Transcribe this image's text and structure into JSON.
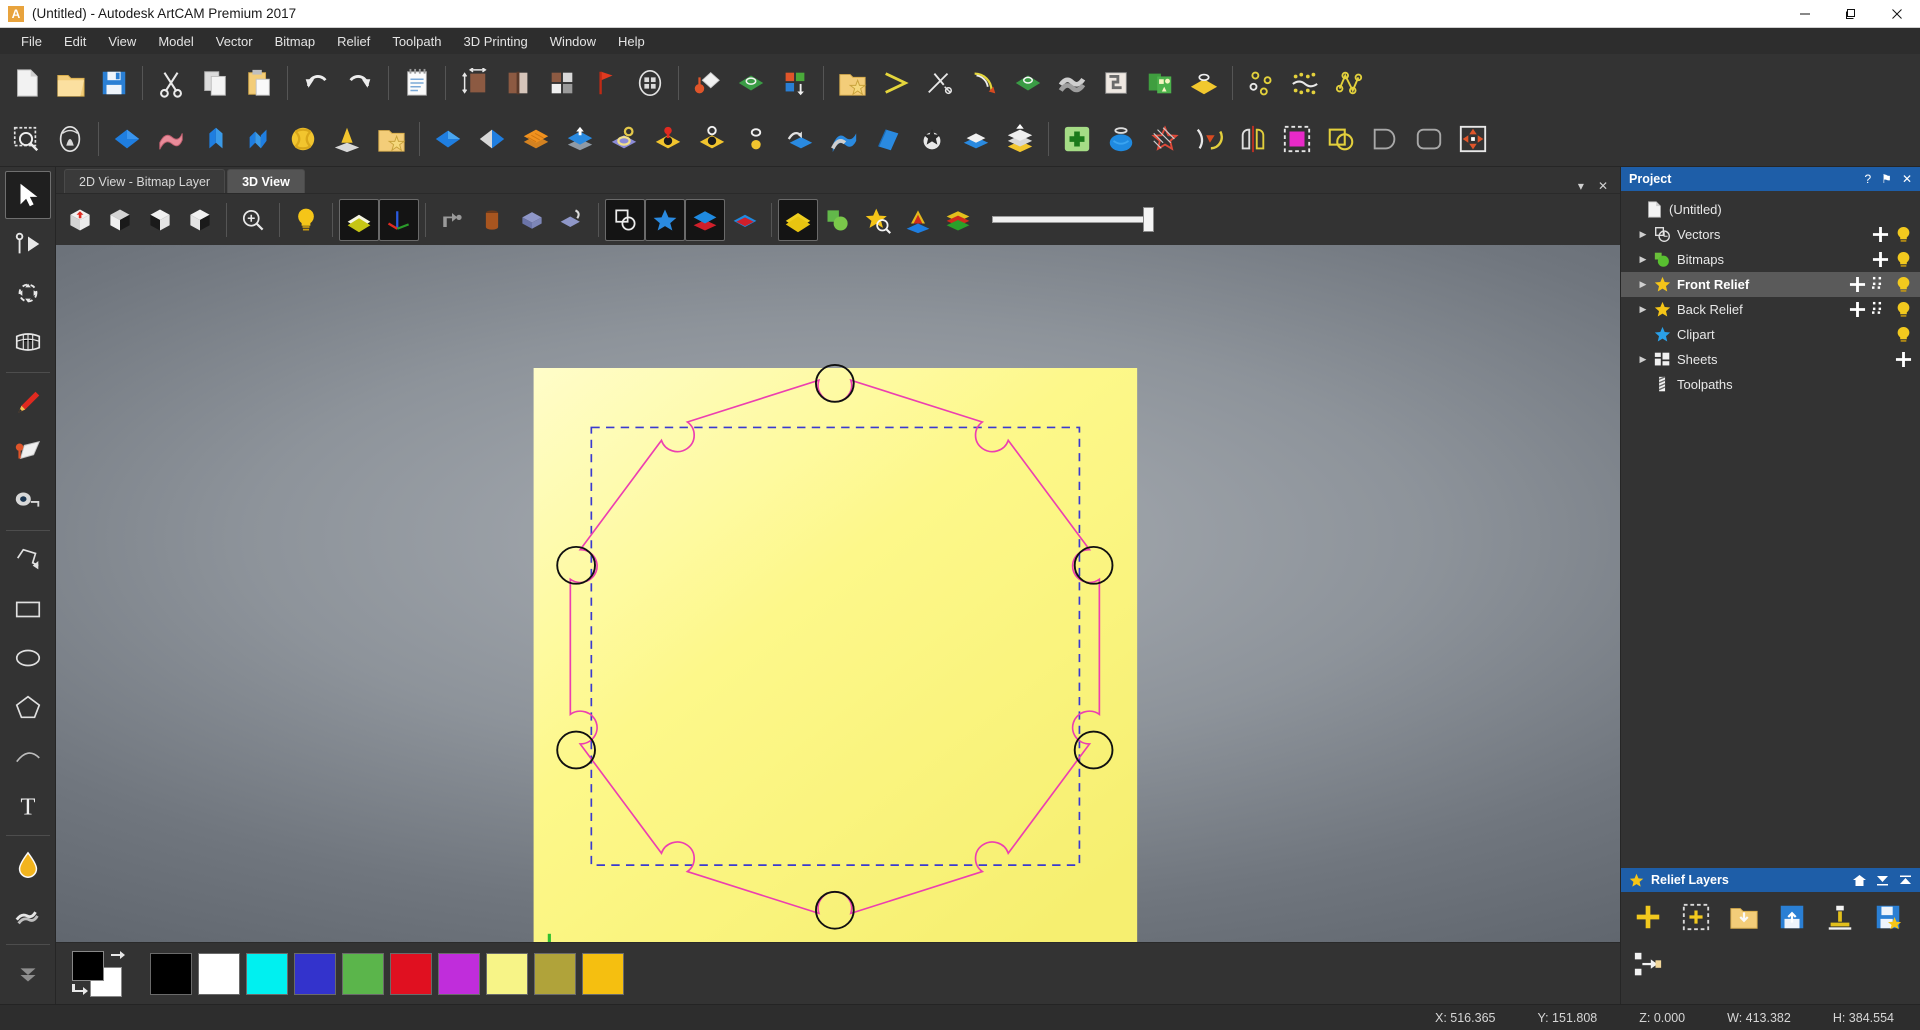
{
  "window": {
    "title": "(Untitled) - Autodesk ArtCAM Premium 2017",
    "logo_letter": "A",
    "minimize": "—",
    "maximize": "❐",
    "close": "✕"
  },
  "menubar": {
    "items": [
      {
        "label": "File"
      },
      {
        "label": "Edit"
      },
      {
        "label": "View"
      },
      {
        "label": "Model"
      },
      {
        "label": "Vector"
      },
      {
        "label": "Bitmap"
      },
      {
        "label": "Relief"
      },
      {
        "label": "Toolpath"
      },
      {
        "label": "3D Printing"
      },
      {
        "label": "Window"
      },
      {
        "label": "Help"
      }
    ]
  },
  "toolbar_main": {
    "groups": [
      {
        "buttons": [
          {
            "name": "new-model-icon",
            "title": "New Model"
          },
          {
            "name": "open-model-icon",
            "title": "Open Model"
          },
          {
            "name": "save-model-icon",
            "title": "Save Model"
          }
        ]
      },
      {
        "buttons": [
          {
            "name": "cut-icon",
            "title": "Cut"
          },
          {
            "name": "copy-icon",
            "title": "Copy"
          },
          {
            "name": "paste-icon",
            "title": "Paste"
          }
        ]
      },
      {
        "buttons": [
          {
            "name": "undo-icon",
            "title": "Undo"
          },
          {
            "name": "redo-icon",
            "title": "Redo"
          }
        ]
      },
      {
        "buttons": [
          {
            "name": "notes-icon",
            "title": "Notes"
          }
        ]
      },
      {
        "buttons": [
          {
            "name": "model-size-icon",
            "title": "Set Model Size"
          },
          {
            "name": "model-thickness-icon",
            "title": "Material Setup"
          },
          {
            "name": "model-layers-icon",
            "title": "Model Layers"
          },
          {
            "name": "zero-datum-icon",
            "title": "Set Datum"
          },
          {
            "name": "model-preview-icon",
            "title": "Model Preview"
          }
        ]
      },
      {
        "buttons": [
          {
            "name": "create-shape-icon",
            "title": "Shape Editor"
          },
          {
            "name": "extrude-icon",
            "title": "Extrude"
          },
          {
            "name": "relief-layers-icon",
            "title": "Relief Layers"
          }
        ]
      },
      {
        "buttons": [
          {
            "name": "vector-library-icon",
            "title": "Vector Library"
          },
          {
            "name": "vector-offset-icon",
            "title": "Offset Vector"
          },
          {
            "name": "vector-trim-icon",
            "title": "Trim Vectors"
          },
          {
            "name": "vector-fillet-icon",
            "title": "Fillet"
          },
          {
            "name": "vector-extrude-icon",
            "title": "Vector Extrude"
          },
          {
            "name": "vector-texture-icon",
            "title": "Texture"
          },
          {
            "name": "vector-nesting-icon",
            "title": "Nesting"
          },
          {
            "name": "sheet-layout-icon",
            "title": "Sheet Layout"
          },
          {
            "name": "tool-plate-icon",
            "title": "Plate"
          }
        ]
      },
      {
        "buttons": [
          {
            "name": "node-edit-points-icon",
            "title": "Node Editing"
          },
          {
            "name": "scatter-points-icon",
            "title": "Scatter"
          },
          {
            "name": "spline-points-icon",
            "title": "Spline Points"
          }
        ]
      }
    ]
  },
  "toolbar_secondary": {
    "groups": [
      {
        "buttons": [
          {
            "name": "zoom-region-icon",
            "title": "Zoom To Region"
          },
          {
            "name": "shape-editor-icon",
            "title": "Shape Editor"
          }
        ]
      },
      {
        "buttons": [
          {
            "name": "relief-diamond-icon",
            "title": "Create Relief"
          },
          {
            "name": "relief-wave-icon",
            "title": "Wave"
          },
          {
            "name": "relief-merge-icon",
            "title": "Merge High"
          },
          {
            "name": "relief-split-icon",
            "title": "Split Relief"
          },
          {
            "name": "relief-weave-icon",
            "title": "Weave"
          },
          {
            "name": "relief-emboss-icon",
            "title": "Emboss"
          },
          {
            "name": "relief-library-icon",
            "title": "Relief Library"
          }
        ]
      },
      {
        "buttons": [
          {
            "name": "blue-diamond-icon",
            "title": "Shape"
          },
          {
            "name": "half-shape-icon",
            "title": "Two Rail Sweep"
          },
          {
            "name": "stripes-icon",
            "title": "Texture Relief"
          },
          {
            "name": "layer-up-icon",
            "title": "Raise Layer"
          },
          {
            "name": "ring-shape-icon",
            "title": "Ring"
          },
          {
            "name": "dome-red-icon",
            "title": "Dome"
          },
          {
            "name": "bead-icon",
            "title": "Bead"
          },
          {
            "name": "dot-icon",
            "title": "Dot"
          },
          {
            "name": "smooth-relief-icon",
            "title": "Smooth"
          },
          {
            "name": "sculpt-icon",
            "title": "Sculpting"
          },
          {
            "name": "fold-relief-icon",
            "title": "Fold"
          },
          {
            "name": "star-relief-icon",
            "title": "Clipart"
          },
          {
            "name": "flat-relief-icon",
            "title": "Flat Relief"
          },
          {
            "name": "stack-relief-icon",
            "title": "Stack Layers"
          }
        ]
      },
      {
        "buttons": [
          {
            "name": "add-green-icon",
            "title": "Add"
          },
          {
            "name": "vase-icon",
            "title": "Vase"
          },
          {
            "name": "star-hatch-icon",
            "title": "Texture Fill"
          },
          {
            "name": "bend-arrow-icon",
            "title": "Bend"
          },
          {
            "name": "mirror-icon",
            "title": "Mirror"
          },
          {
            "name": "bitmap-select-icon",
            "title": "Bitmap Selection"
          },
          {
            "name": "boolean-icon",
            "title": "Boolean"
          },
          {
            "name": "shape-c-icon",
            "title": "Shape C"
          },
          {
            "name": "rounded-rect-icon",
            "title": "Rounded Rectangle"
          },
          {
            "name": "move-tool-icon",
            "title": "Move"
          }
        ]
      }
    ]
  },
  "left_toolbar": {
    "items": [
      {
        "name": "select-tool",
        "title": "Select",
        "active": true
      },
      {
        "name": "node-edit-tool",
        "title": "Node Editing",
        "active": false
      },
      {
        "name": "transform-tool",
        "title": "Transform",
        "active": false
      },
      {
        "name": "distort-tool",
        "title": "Distort",
        "active": false
      },
      {
        "name": "pencil-tool",
        "title": "Pencil",
        "active": false
      },
      {
        "name": "paint-tool",
        "title": "Paint",
        "active": false
      },
      {
        "name": "measure-tool",
        "title": "Measure",
        "active": false
      },
      {
        "name": "polyline-tool",
        "title": "Polyline",
        "active": false
      },
      {
        "name": "rectangle-tool",
        "title": "Rectangle",
        "active": false
      },
      {
        "name": "ellipse-tool",
        "title": "Ellipse",
        "active": false
      },
      {
        "name": "polygon-tool",
        "title": "Polygon",
        "active": false
      },
      {
        "name": "arc-tool",
        "title": "Arc",
        "active": false
      },
      {
        "name": "text-tool",
        "title": "Text",
        "active": false
      },
      {
        "name": "fill-tool",
        "title": "Flood Fill",
        "active": false
      },
      {
        "name": "smudge-tool",
        "title": "Smudge",
        "active": false
      },
      {
        "name": "more-tools-chevron",
        "title": "More Tools",
        "active": false
      }
    ]
  },
  "document_tabs": {
    "tabs": [
      {
        "label": "2D View - Bitmap Layer",
        "active": false
      },
      {
        "label": "3D View",
        "active": true
      }
    ],
    "minimize_icon": "▾",
    "close_icon": "✕"
  },
  "view3d_toolbar": {
    "buttons": [
      {
        "name": "view-top-icon",
        "title": "Top View",
        "pressed": false
      },
      {
        "name": "view-bottom-icon",
        "title": "Bottom View",
        "pressed": false
      },
      {
        "name": "view-iso-left-icon",
        "title": "Isometric Left",
        "pressed": false
      },
      {
        "name": "view-iso-right-icon",
        "title": "Isometric Right",
        "pressed": false
      },
      {
        "name": "zoom-icon",
        "title": "Zoom",
        "pressed": false
      },
      {
        "name": "light-bulb-icon",
        "title": "Lighting",
        "pressed": false
      },
      {
        "name": "shade-relief-icon",
        "title": "Shade Relief",
        "pressed": true
      },
      {
        "name": "axes-icon",
        "title": "Show Axes",
        "pressed": true
      },
      {
        "name": "show-toolpath-icon",
        "title": "Show Toolpaths",
        "pressed": false
      },
      {
        "name": "simulate-material-icon",
        "title": "Simulate Material",
        "pressed": false
      },
      {
        "name": "blue-block-icon",
        "title": "Block",
        "pressed": false
      },
      {
        "name": "machining-icon",
        "title": "Simulation",
        "pressed": false
      },
      {
        "name": "show-vectors-icon",
        "title": "Show Vectors",
        "pressed": true
      },
      {
        "name": "show-clipart-icon",
        "title": "Show Clipart",
        "pressed": true
      },
      {
        "name": "front-relief-icon",
        "title": "Front Relief",
        "pressed": true
      },
      {
        "name": "back-relief-icon",
        "title": "Back Relief",
        "pressed": false
      },
      {
        "name": "composite-relief-icon",
        "title": "Composite Relief",
        "pressed": true
      },
      {
        "name": "green-shape-icon",
        "title": "Green Shape",
        "pressed": false
      },
      {
        "name": "zoom-clipart-icon",
        "title": "Zoom Clipart",
        "pressed": false
      },
      {
        "name": "color-shade-icon",
        "title": "Color Shade",
        "pressed": false
      },
      {
        "name": "rainbow-icon",
        "title": "Colour Relief",
        "pressed": false
      }
    ],
    "slider": {
      "name": "relief-scale-slider",
      "value": 100,
      "min": 0,
      "max": 100
    }
  },
  "canvas": {
    "plate_color": "#fdf88a",
    "plate_color_light": "#fffcc2",
    "vector_color": "#ec3fb0",
    "selection_color": "#3a3ad0",
    "node_color": "#101010",
    "axis": {
      "x_color": "#e03010",
      "y_color": "#2fbf2f",
      "z_color": "#2020e0"
    },
    "shape": {
      "type": "gear-outline",
      "sides": 10,
      "node_circles": 6,
      "description": "Decagonal vector outline with rounded bumps at each vertex"
    }
  },
  "palette": {
    "foreground": "#000000",
    "background": "#ffffff",
    "swap_icon": "swap-colors-icon",
    "reset_icon": "reset-colors-icon",
    "colors": [
      {
        "name": "black",
        "hex": "#000000"
      },
      {
        "name": "white",
        "hex": "#ffffff"
      },
      {
        "name": "cyan",
        "hex": "#00f0f0"
      },
      {
        "name": "blue",
        "hex": "#3333cc"
      },
      {
        "name": "green",
        "hex": "#5bb54b"
      },
      {
        "name": "red",
        "hex": "#e01020"
      },
      {
        "name": "magenta",
        "hex": "#c02ddb"
      },
      {
        "name": "pale-yellow",
        "hex": "#f7f487"
      },
      {
        "name": "olive",
        "hex": "#b0a33a"
      },
      {
        "name": "gold",
        "hex": "#f5bf10"
      }
    ]
  },
  "project_panel": {
    "title": "Project",
    "help_icon": "?",
    "pin_icon": "⚑",
    "close_icon": "✕",
    "items": [
      {
        "label": "(Untitled)",
        "icon": "document-icon",
        "expandable": false,
        "indent": 0,
        "selected": false,
        "actions": []
      },
      {
        "label": "Vectors",
        "icon": "vectors-icon",
        "expandable": true,
        "indent": 1,
        "selected": false,
        "actions": [
          "add",
          "bulb"
        ]
      },
      {
        "label": "Bitmaps",
        "icon": "bitmaps-icon",
        "expandable": true,
        "indent": 1,
        "selected": false,
        "actions": [
          "add",
          "bulb"
        ]
      },
      {
        "label": "Front Relief",
        "icon": "relief-star-icon",
        "expandable": true,
        "indent": 1,
        "selected": true,
        "actions": [
          "add",
          "grid",
          "bulb"
        ]
      },
      {
        "label": "Back Relief",
        "icon": "relief-star-icon",
        "expandable": true,
        "indent": 1,
        "selected": false,
        "actions": [
          "add",
          "grid",
          "bulb"
        ]
      },
      {
        "label": "Clipart",
        "icon": "clipart-star-icon",
        "expandable": false,
        "indent": 1,
        "selected": false,
        "actions": [
          "bulb"
        ]
      },
      {
        "label": "Sheets",
        "icon": "sheets-icon",
        "expandable": true,
        "indent": 1,
        "selected": false,
        "actions": [
          "add"
        ]
      },
      {
        "label": "Toolpaths",
        "icon": "toolpaths-icon",
        "expandable": false,
        "indent": 1,
        "selected": false,
        "actions": []
      }
    ]
  },
  "relief_layers_panel": {
    "title": "Relief Layers",
    "title_icon": "relief-star-icon",
    "header_actions": [
      "home-icon",
      "collapse-down-icon",
      "collapse-up-icon"
    ],
    "buttons": [
      {
        "name": "add-layer-button",
        "title": "Add New Relief Layer"
      },
      {
        "name": "add-selection-layer-button",
        "title": "Add Layer From Selection"
      },
      {
        "name": "import-layer-button",
        "title": "Import Relief Layer"
      },
      {
        "name": "export-layer-button",
        "title": "Export Relief Layer"
      },
      {
        "name": "stamp-layer-button",
        "title": "Stamp"
      },
      {
        "name": "save-layer-clipart-button",
        "title": "Save As Clipart"
      },
      {
        "name": "link-layer-button",
        "title": "Link Layer"
      }
    ]
  },
  "statusbar": {
    "readouts": [
      {
        "name": "x-coordinate",
        "text": "X: 516.365"
      },
      {
        "name": "y-coordinate",
        "text": "Y: 151.808"
      },
      {
        "name": "z-coordinate",
        "text": "Z: 0.000"
      },
      {
        "name": "width-readout",
        "text": "W: 413.382"
      },
      {
        "name": "height-readout",
        "text": "H: 384.554"
      }
    ]
  }
}
